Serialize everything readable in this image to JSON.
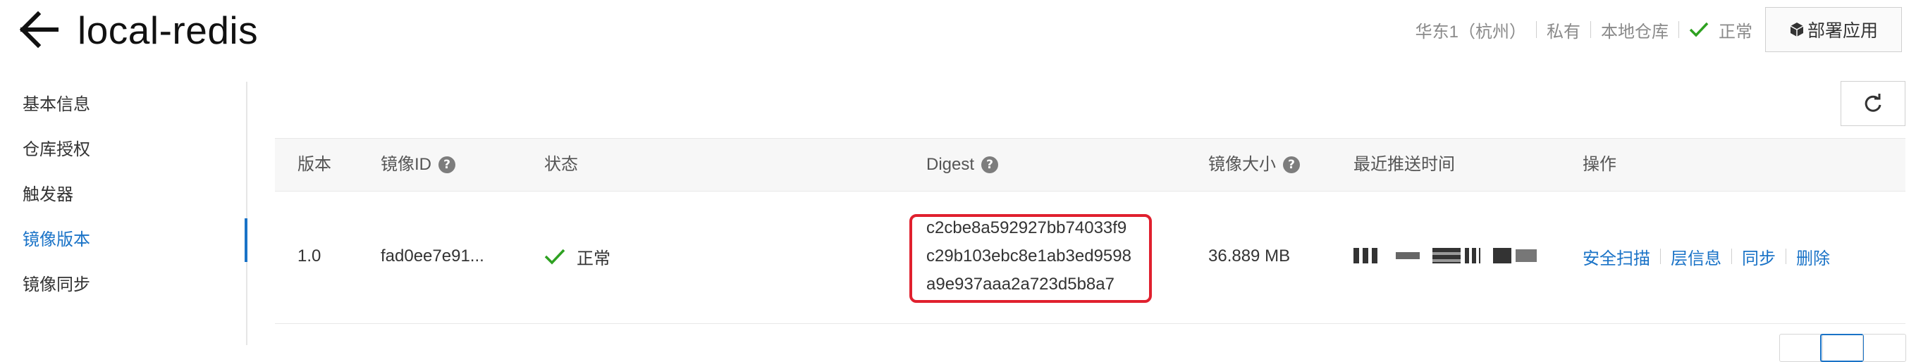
{
  "header": {
    "title": "local-redis",
    "region": "华东1（杭州）",
    "visibility": "私有",
    "repo_type": "本地仓库",
    "status": "正常",
    "deploy_label": "部署应用"
  },
  "sidebar": {
    "items": [
      {
        "label": "基本信息"
      },
      {
        "label": "仓库授权"
      },
      {
        "label": "触发器"
      },
      {
        "label": "镜像版本"
      },
      {
        "label": "镜像同步"
      }
    ],
    "active": "镜像版本"
  },
  "table": {
    "columns": {
      "version": "版本",
      "image_id": "镜像ID",
      "status": "状态",
      "digest": "Digest",
      "size": "镜像大小",
      "pushed_at": "最近推送时间",
      "actions": "操作"
    },
    "rows": [
      {
        "version": "1.0",
        "image_id": "fad0ee7e91...",
        "status": "正常",
        "digest_lines": [
          "c2cbe8a592927bb74033f9",
          "c29b103ebc8e1ab3ed9598",
          "a9e937aaa2a723d5b8a7"
        ],
        "size": "36.889 MB",
        "actions": [
          "安全扫描",
          "层信息",
          "同步",
          "删除"
        ]
      }
    ]
  },
  "colors": {
    "accent": "#1a73c7",
    "success": "#2ea121",
    "highlight_border": "#e0202e"
  },
  "icons": [
    "back-arrow-icon",
    "check-icon",
    "cube-icon",
    "refresh-icon",
    "help-icon"
  ]
}
